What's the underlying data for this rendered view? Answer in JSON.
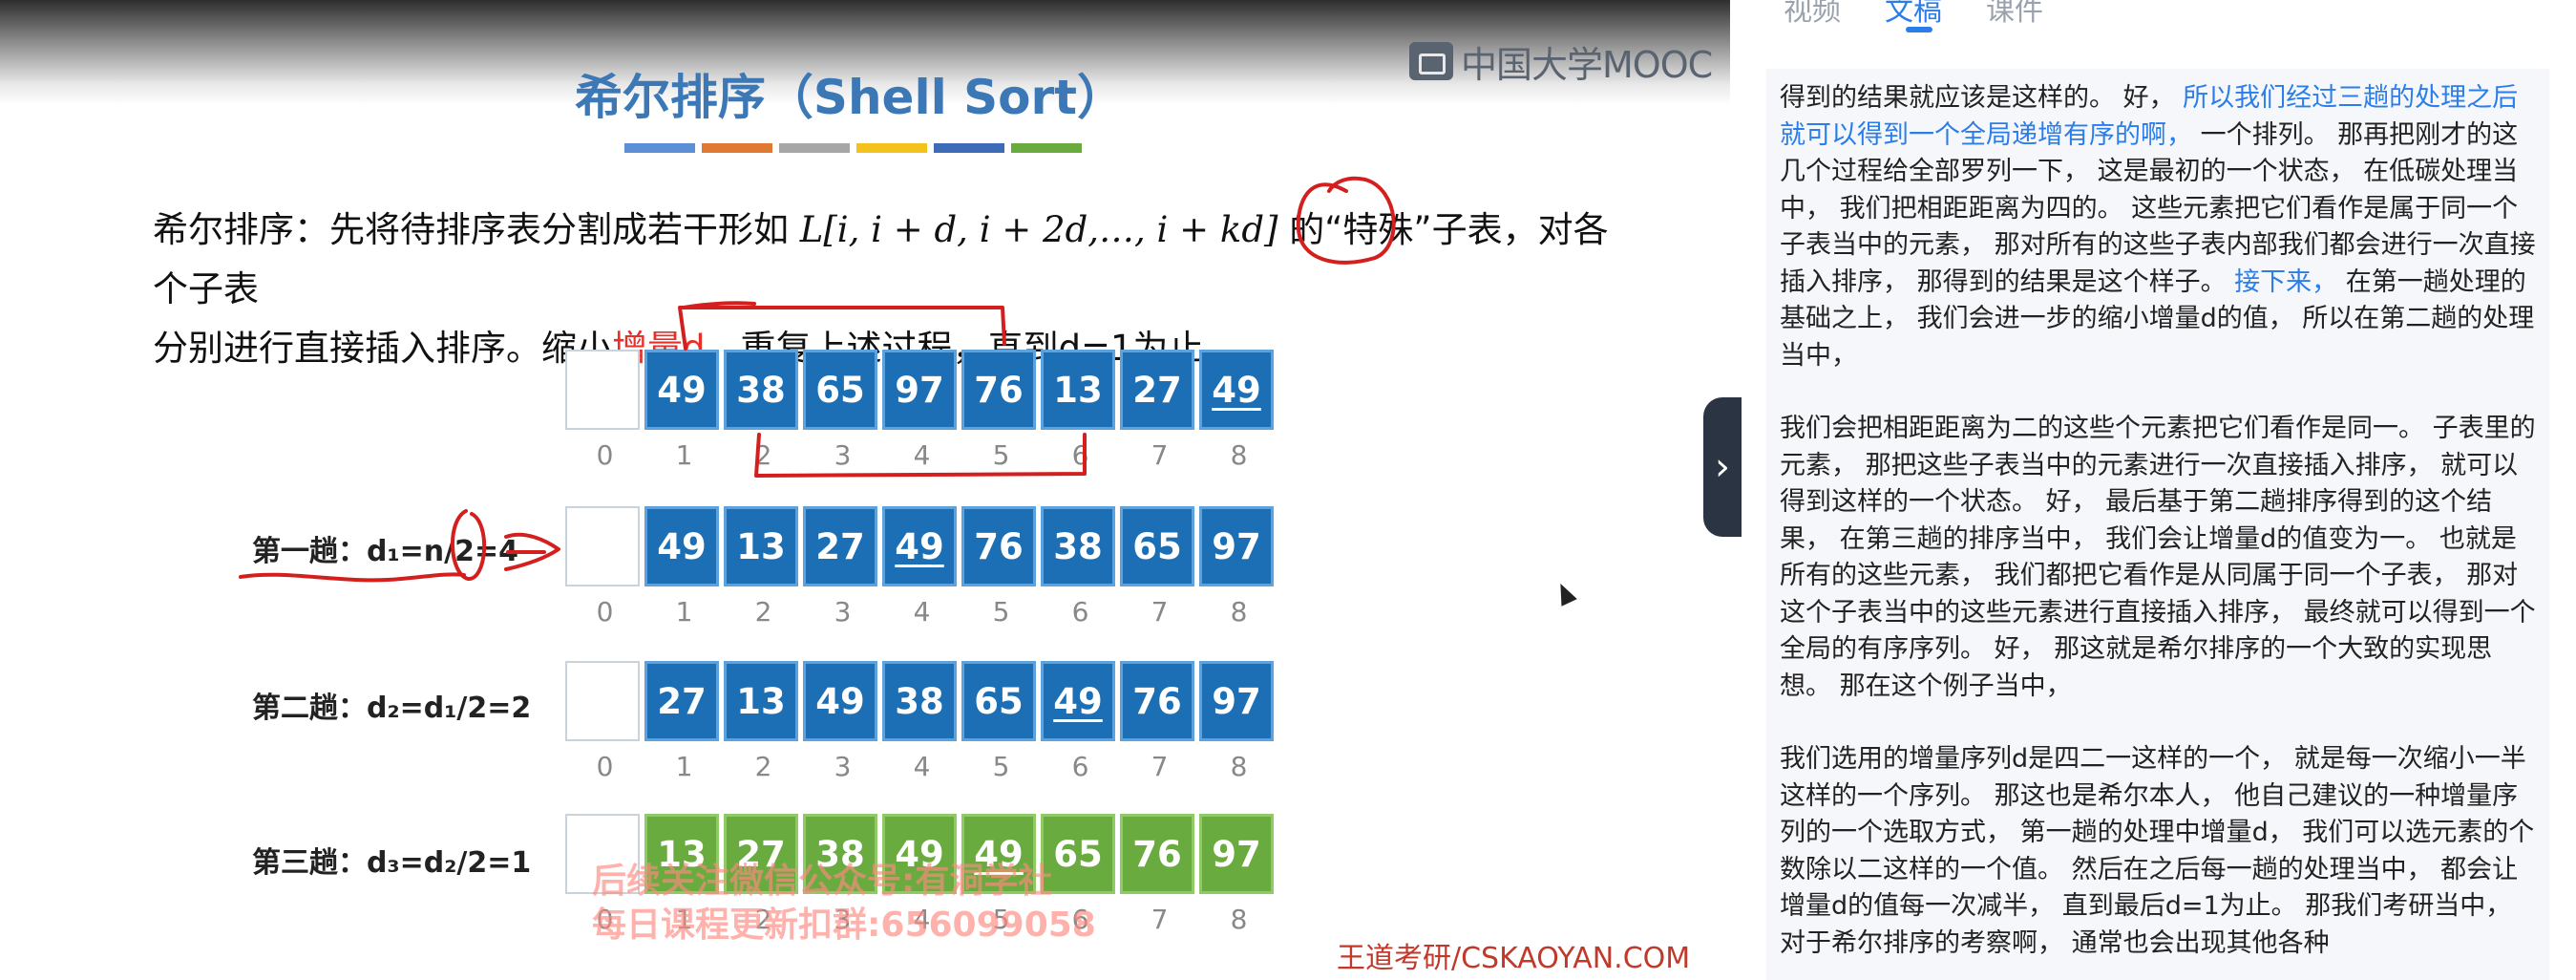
{
  "slide": {
    "logo_text": "中国大学MOOC",
    "title": "希尔排序（Shell Sort）",
    "title_bar_colors": [
      "#5b8fd6",
      "#e07a33",
      "#a6a6a6",
      "#f4c21c",
      "#3d6bb8",
      "#6aab3f"
    ],
    "desc_line1_pre": "希尔排序：先将待排序表分割成若干形如 ",
    "desc_math": "L[i, i + d, i + 2d,…, i + kd]",
    "desc_line1_post": " 的“特殊”子表，对各个子表",
    "desc_line2_a": "分别进行直接插入排序。缩小",
    "desc_line2_red": "增量d",
    "desc_line2_b": "，重复上述过程，直到d=1为止。",
    "indices": [
      "0",
      "1",
      "2",
      "3",
      "4",
      "5",
      "6",
      "7",
      "8"
    ],
    "rows": [
      {
        "label": "",
        "cells": [
          "",
          "49",
          "38",
          "65",
          "97",
          "76",
          "13",
          "27",
          "49"
        ],
        "underline": [
          8
        ],
        "color": "blue"
      },
      {
        "label": "第一趟：d₁=n/2=4",
        "cells": [
          "",
          "49",
          "13",
          "27",
          "49",
          "76",
          "38",
          "65",
          "97"
        ],
        "underline": [
          4
        ],
        "color": "blue"
      },
      {
        "label": "第二趟：d₂=d₁/2=2",
        "cells": [
          "",
          "27",
          "13",
          "49",
          "38",
          "65",
          "49",
          "76",
          "97"
        ],
        "underline": [
          6
        ],
        "color": "blue"
      },
      {
        "label": "第三趟：d₃=d₂/2=1",
        "cells": [
          "",
          "13",
          "27",
          "38",
          "49",
          "49",
          "65",
          "76",
          "97"
        ],
        "underline": [
          5
        ],
        "color": "green"
      }
    ],
    "watermark_line1": "后续关注微信公众号:有洞学社",
    "watermark_line2": "每日课程更新扣群:656099058",
    "source": "王道考研/CSKAOYAN.COM"
  },
  "handle_icon": "›",
  "tabs": [
    "视频",
    "文稿",
    "课件"
  ],
  "active_tab": 1,
  "transcript": {
    "p1a": "得到的结果就应该是这样的。 好， ",
    "p1_hl": "所以我们经过三趟的处理之后就可以得到一个全局递增有序的啊，",
    "p1b": " 一个排列。 那再把刚才的这几个过程给全部罗列一下， 这是最初的一个状态， 在低碳处理当中， 我们把相距距离为四的。 这些元素把它们看作是属于同一个子表当中的元素， 那对所有的这些子表内部我们都会进行一次直接插入排序， 那得到的结果是这个样子。 ",
    "p1_hl2": "接下来，",
    "p1c": " 在第一趟处理的基础之上， 我们会进一步的缩小增量d的值， 所以在第二趟的处理当中，",
    "p2": "我们会把相距距离为二的这些个元素把它们看作是同一。 子表里的元素， 那把这些子表当中的元素进行一次直接插入排序， 就可以得到这样的一个状态。 好， 最后基于第二趟排序得到的这个结果， 在第三趟的排序当中， 我们会让增量d的值变为一。 也就是所有的这些元素， 我们都把它看作是从同属于同一个子表， 那对这个子表当中的这些元素进行直接插入排序， 最终就可以得到一个全局的有序序列。 好， 那这就是希尔排序的一个大致的实现思想。 那在这个例子当中，",
    "p3": "我们选用的增量序列d是四二一这样的一个， 就是每一次缩小一半这样的一个序列。 那这也是希尔本人， 他自己建议的一种增量序列的一个选取方式， 第一趟的处理中增量d， 我们可以选元素的个数除以二这样的一个值。 然后在之后每一趟的处理当中， 都会让增量d的值每一次减半， 直到最后d=1为止。 那我们考研当中， 对于希尔排序的考察啊， 通常也会出现其他各种"
  }
}
